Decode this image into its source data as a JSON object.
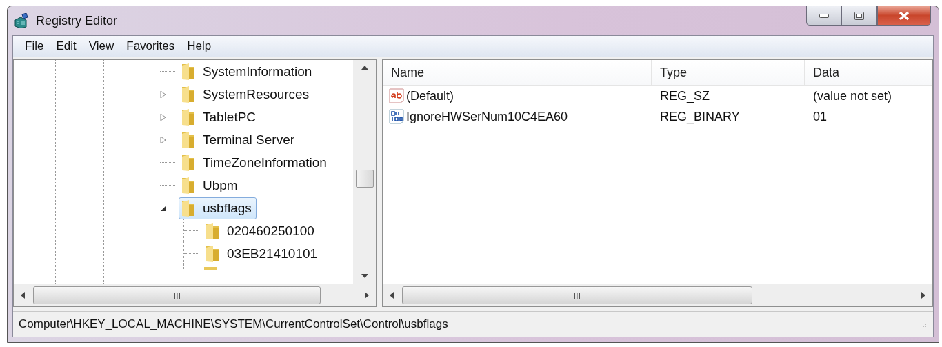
{
  "window": {
    "title": "Registry Editor"
  },
  "menu": [
    "File",
    "Edit",
    "View",
    "Favorites",
    "Help"
  ],
  "tree": [
    {
      "label": "SystemInformation",
      "kind": "leaf",
      "selected": false
    },
    {
      "label": "SystemResources",
      "kind": "collapsed",
      "selected": false
    },
    {
      "label": "TabletPC",
      "kind": "collapsed",
      "selected": false
    },
    {
      "label": "Terminal Server",
      "kind": "collapsed",
      "selected": false
    },
    {
      "label": "TimeZoneInformation",
      "kind": "leaf",
      "selected": false
    },
    {
      "label": "Ubpm",
      "kind": "leaf",
      "selected": false
    },
    {
      "label": "usbflags",
      "kind": "expanded",
      "selected": true,
      "children": [
        {
          "label": "020460250100",
          "kind": "leaf",
          "selected": false
        },
        {
          "label": "03EB21410101",
          "kind": "leaf",
          "selected": false
        }
      ]
    }
  ],
  "table": {
    "columns": [
      "Name",
      "Type",
      "Data"
    ],
    "rows": [
      {
        "kind": "string",
        "name": "(Default)",
        "type": "REG_SZ",
        "data": "(value not set)"
      },
      {
        "kind": "binary",
        "name": "IgnoreHWSerNum10C4EA60",
        "type": "REG_BINARY",
        "data": "01"
      }
    ]
  },
  "status_bar": "Computer\\HKEY_LOCAL_MACHINE\\SYSTEM\\CurrentControlSet\\Control\\usbflags"
}
